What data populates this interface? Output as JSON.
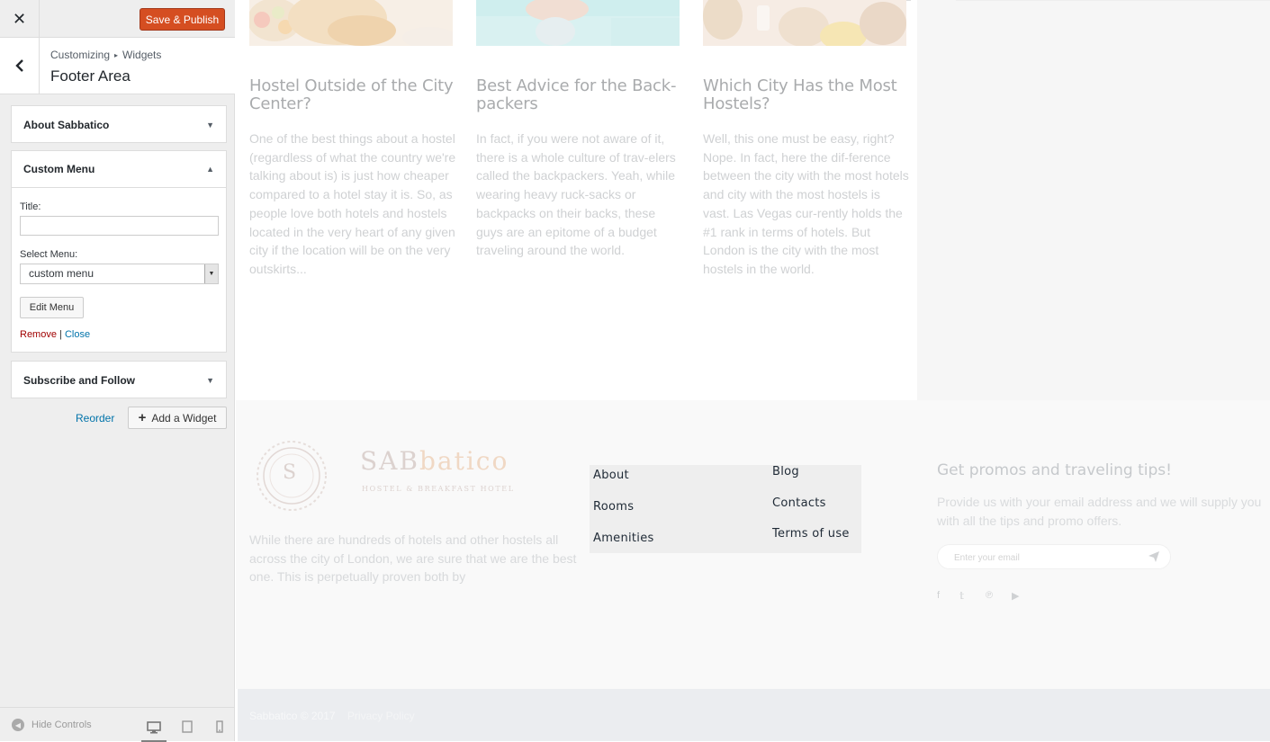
{
  "topbar": {
    "close_glyph": "✕",
    "save_label": "Save & Publish"
  },
  "section": {
    "breadcrumb_root": "Customizing",
    "breadcrumb_sep": "▸",
    "breadcrumb_child": "Widgets",
    "title": "Footer Area"
  },
  "widgets": [
    {
      "title": "About Sabbatico",
      "expanded": false
    },
    {
      "title": "Custom Menu",
      "expanded": true
    },
    {
      "title": "Subscribe and Follow",
      "expanded": false
    }
  ],
  "custom_menu": {
    "title_label": "Title:",
    "title_value": "",
    "select_label": "Select Menu:",
    "select_value": "custom menu",
    "edit_menu_label": "Edit Menu",
    "remove_label": "Remove",
    "pipe": "|",
    "close_label": "Close"
  },
  "actions": {
    "reorder_label": "Reorder",
    "add_widget_label": "Add a Widget"
  },
  "controls": {
    "hide_label": "Hide Controls",
    "devices": [
      "desktop",
      "tablet",
      "mobile"
    ],
    "active_device": "desktop"
  },
  "posts": [
    {
      "title": "Hostel Outside of the City Center?",
      "excerpt": "One of the best things about a hostel (regardless of what the country we're talking about is) is just how cheaper compared to a hotel stay it is. So, as people love both hotels and hostels located in the very heart of any given city if the location will be on the very outskirts..."
    },
    {
      "title": "Best Advice for the Back-packers",
      "excerpt": "In fact, if you were not aware of it, there is a whole culture of trav-elers called the backpackers. Yeah, while wearing heavy ruck-sacks or backpacks on their backs, these guys are an epitome of a budget traveling around the world."
    },
    {
      "title": "Which City Has the Most Hostels?",
      "excerpt": "Well, this one must be easy, right? Nope. In fact, here the dif-ference between the city with the most hotels and city with the most hostels is vast. Las Vegas cur-rently holds the #1 rank in terms of hotels. But London is the city with the most hostels in the world."
    }
  ],
  "footer": {
    "logo_initial": "S",
    "logo_word_a": "SAB",
    "logo_word_b": "batico",
    "logo_tagline": "HOSTEL & BREAKFAST HOTEL",
    "about_text": "While there are hundreds of hotels and other hostels all across the city of London, we are sure that we are the best one. This is perpetually proven both by",
    "menu": {
      "left": [
        "About",
        "Rooms",
        "Amenities"
      ],
      "right": [
        "Blog",
        "Contacts",
        "Terms of use"
      ]
    },
    "promo_title": "Get promos and traveling tips!",
    "promo_text": "Provide us with your email address and we will supply you with all the tips and promo offers.",
    "email_placeholder": "Enter your email",
    "social": [
      "facebook",
      "twitter",
      "pinterest",
      "youtube"
    ],
    "social_glyphs": [
      "f",
      "𝕥",
      "℗",
      "▶"
    ],
    "copyright": "Sabbatico © 2017",
    "privacy": "Privacy Policy"
  },
  "colors": {
    "save_button": "#d54e21",
    "link": "#0073aa",
    "remove_link": "#a00000"
  }
}
